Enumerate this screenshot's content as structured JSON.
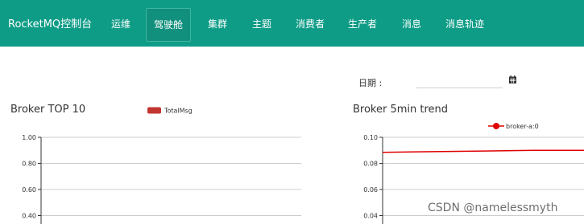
{
  "navbar": {
    "brand": "RocketMQ控制台",
    "items": [
      {
        "label": "运维",
        "active": false
      },
      {
        "label": "驾驶舱",
        "active": true
      },
      {
        "label": "集群",
        "active": false
      },
      {
        "label": "主题",
        "active": false
      },
      {
        "label": "消费者",
        "active": false
      },
      {
        "label": "生产者",
        "active": false
      },
      {
        "label": "消息",
        "active": false
      },
      {
        "label": "消息轨迹",
        "active": false
      }
    ],
    "bg_color": "#0e9c87"
  },
  "date_filter": {
    "label": "日期 :",
    "value": "",
    "icon": "calendar-icon"
  },
  "watermark": "CSDN @namelessmyth",
  "chart_data": [
    {
      "type": "bar",
      "title": "Broker TOP 10",
      "series": [
        {
          "name": "TotalMsg",
          "color": "#c23531",
          "values": []
        }
      ],
      "categories": [],
      "y_ticks": [
        "1.00",
        "0.80",
        "0.60",
        "0.40"
      ],
      "ylim": [
        0,
        1
      ],
      "legend_position": "top-center",
      "grid": true
    },
    {
      "type": "line",
      "title": "Broker 5min trend",
      "series": [
        {
          "name": "broker-a:0",
          "color": "#e00000",
          "values": [
            0.0885,
            0.089,
            0.0895,
            0.09,
            0.09
          ]
        }
      ],
      "y_ticks": [
        "0.10",
        "0.08",
        "0.06",
        "0.04"
      ],
      "ylim": [
        0,
        0.1
      ],
      "legend_position": "top-right",
      "grid": true
    }
  ]
}
